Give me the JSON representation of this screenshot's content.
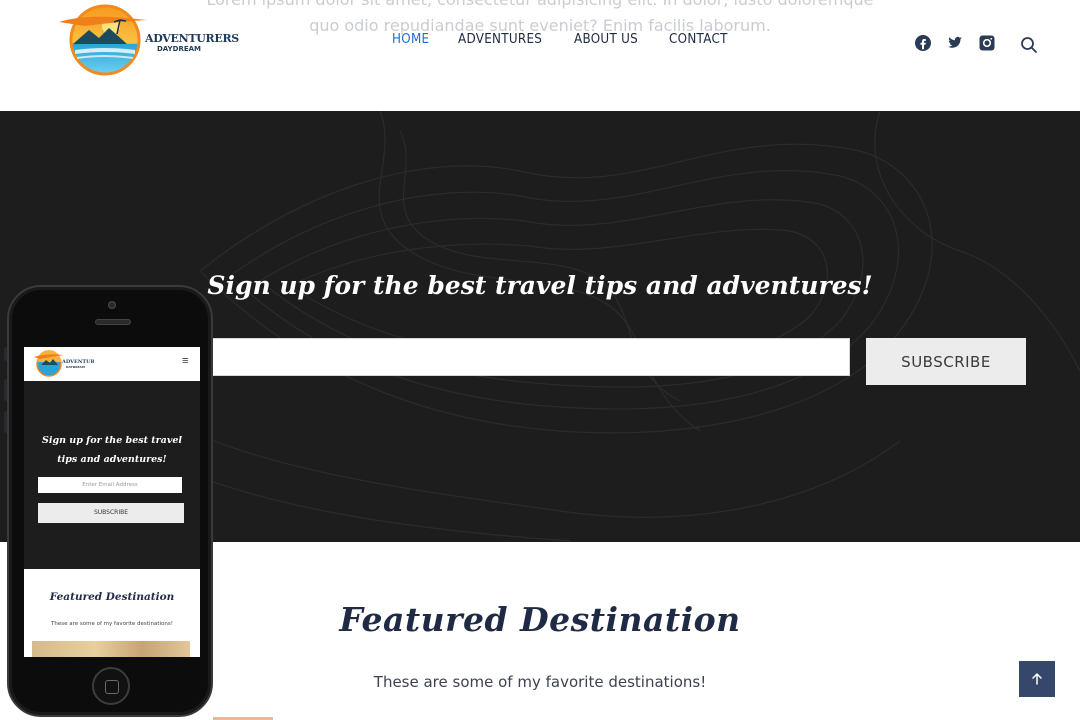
{
  "header": {
    "ghost_line_1": "Lorem ipsum dolor sit amet, consectetur adipisicing elit. In dolor, iusto doloremque",
    "ghost_line_2": "quo odio repudiandae sunt eveniet? Enim facilis laborum.",
    "logo": {
      "line1": "ADVENTURERS",
      "line2": "DAYDREAM"
    },
    "nav": [
      {
        "label": "HOME",
        "active": true
      },
      {
        "label": "ADVENTURES",
        "active": false
      },
      {
        "label": "ABOUT US",
        "active": false
      },
      {
        "label": "CONTACT",
        "active": false
      }
    ],
    "social_icons": [
      "facebook-icon",
      "twitter-icon",
      "instagram-icon",
      "search-icon"
    ]
  },
  "signup": {
    "title": "Sign up for the best travel tips and adventures!",
    "email_value": "",
    "subscribe_label": "SUBSCRIBE"
  },
  "featured": {
    "title": "Featured Destination",
    "subtitle": "These are some of my favorite destinations!"
  },
  "phone": {
    "menu_icon": "≡",
    "title": "Sign up for the best travel tips and adventures!",
    "email_placeholder": "Enter Email Address",
    "subscribe_label": "SUBSCRIBE",
    "featured_title": "Featured Destination",
    "featured_subtitle": "These are some of my favorite destinations!"
  },
  "back_to_top_icon": "arrow-up-icon",
  "colors": {
    "nav_active": "#1f6fd6",
    "navy": "#1f2a44",
    "band_bg": "#1d1d1e",
    "button_bg": "#ececec",
    "back_to_top_bg": "#35476b"
  }
}
